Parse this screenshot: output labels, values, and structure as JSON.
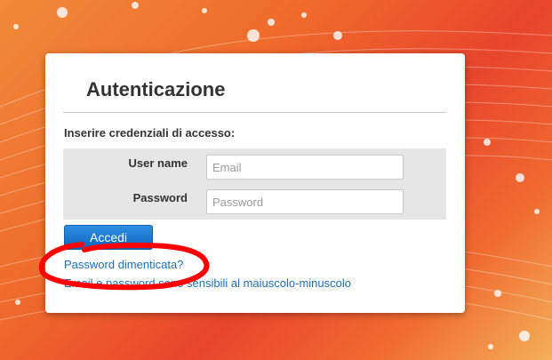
{
  "login": {
    "title": "Autenticazione",
    "instructions": "Inserire credenziali di accesso:",
    "username_label": "User name",
    "username_placeholder": "Email",
    "password_label": "Password",
    "password_placeholder": "Password",
    "submit_label": "Accedi",
    "forgot_password_link": "Password dimenticata?",
    "case_sensitivity_note": "Email e password sono sensibili al maiuscolo-minuscolo"
  },
  "colors": {
    "background_orange": "#ef6a2c",
    "button_blue": "#0e66bd",
    "link_blue": "#1a6fb5",
    "annotation_red": "#ff0000"
  }
}
